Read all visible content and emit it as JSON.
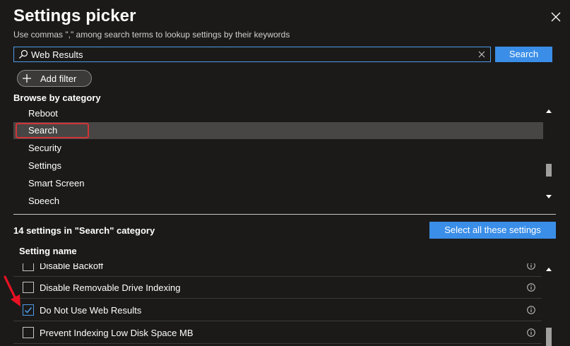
{
  "header": {
    "title": "Settings picker",
    "subtitle": "Use commas \",\" among search terms to lookup settings by their keywords"
  },
  "search": {
    "value": "Web Results",
    "button_label": "Search"
  },
  "filter": {
    "add_label": "Add filter"
  },
  "browse": {
    "heading": "Browse by category",
    "categories": [
      "Reboot",
      "Search",
      "Security",
      "Settings",
      "Smart Screen",
      "Speech"
    ],
    "selected": "Search"
  },
  "results": {
    "count_text": "14 settings in \"Search\" category",
    "select_all_label": "Select all these settings",
    "column_header": "Setting name",
    "settings": [
      {
        "name": "Disable Backoff",
        "checked": false
      },
      {
        "name": "Disable Removable Drive Indexing",
        "checked": false
      },
      {
        "name": "Do Not Use Web Results",
        "checked": true
      },
      {
        "name": "Prevent Indexing Low Disk Space MB",
        "checked": false
      }
    ]
  },
  "colors": {
    "background": "#1b1a19",
    "accent": "#3a8ee8",
    "selected_row": "#484644",
    "highlight_outline": "#d13438",
    "annotation_arrow": "#e81123"
  }
}
